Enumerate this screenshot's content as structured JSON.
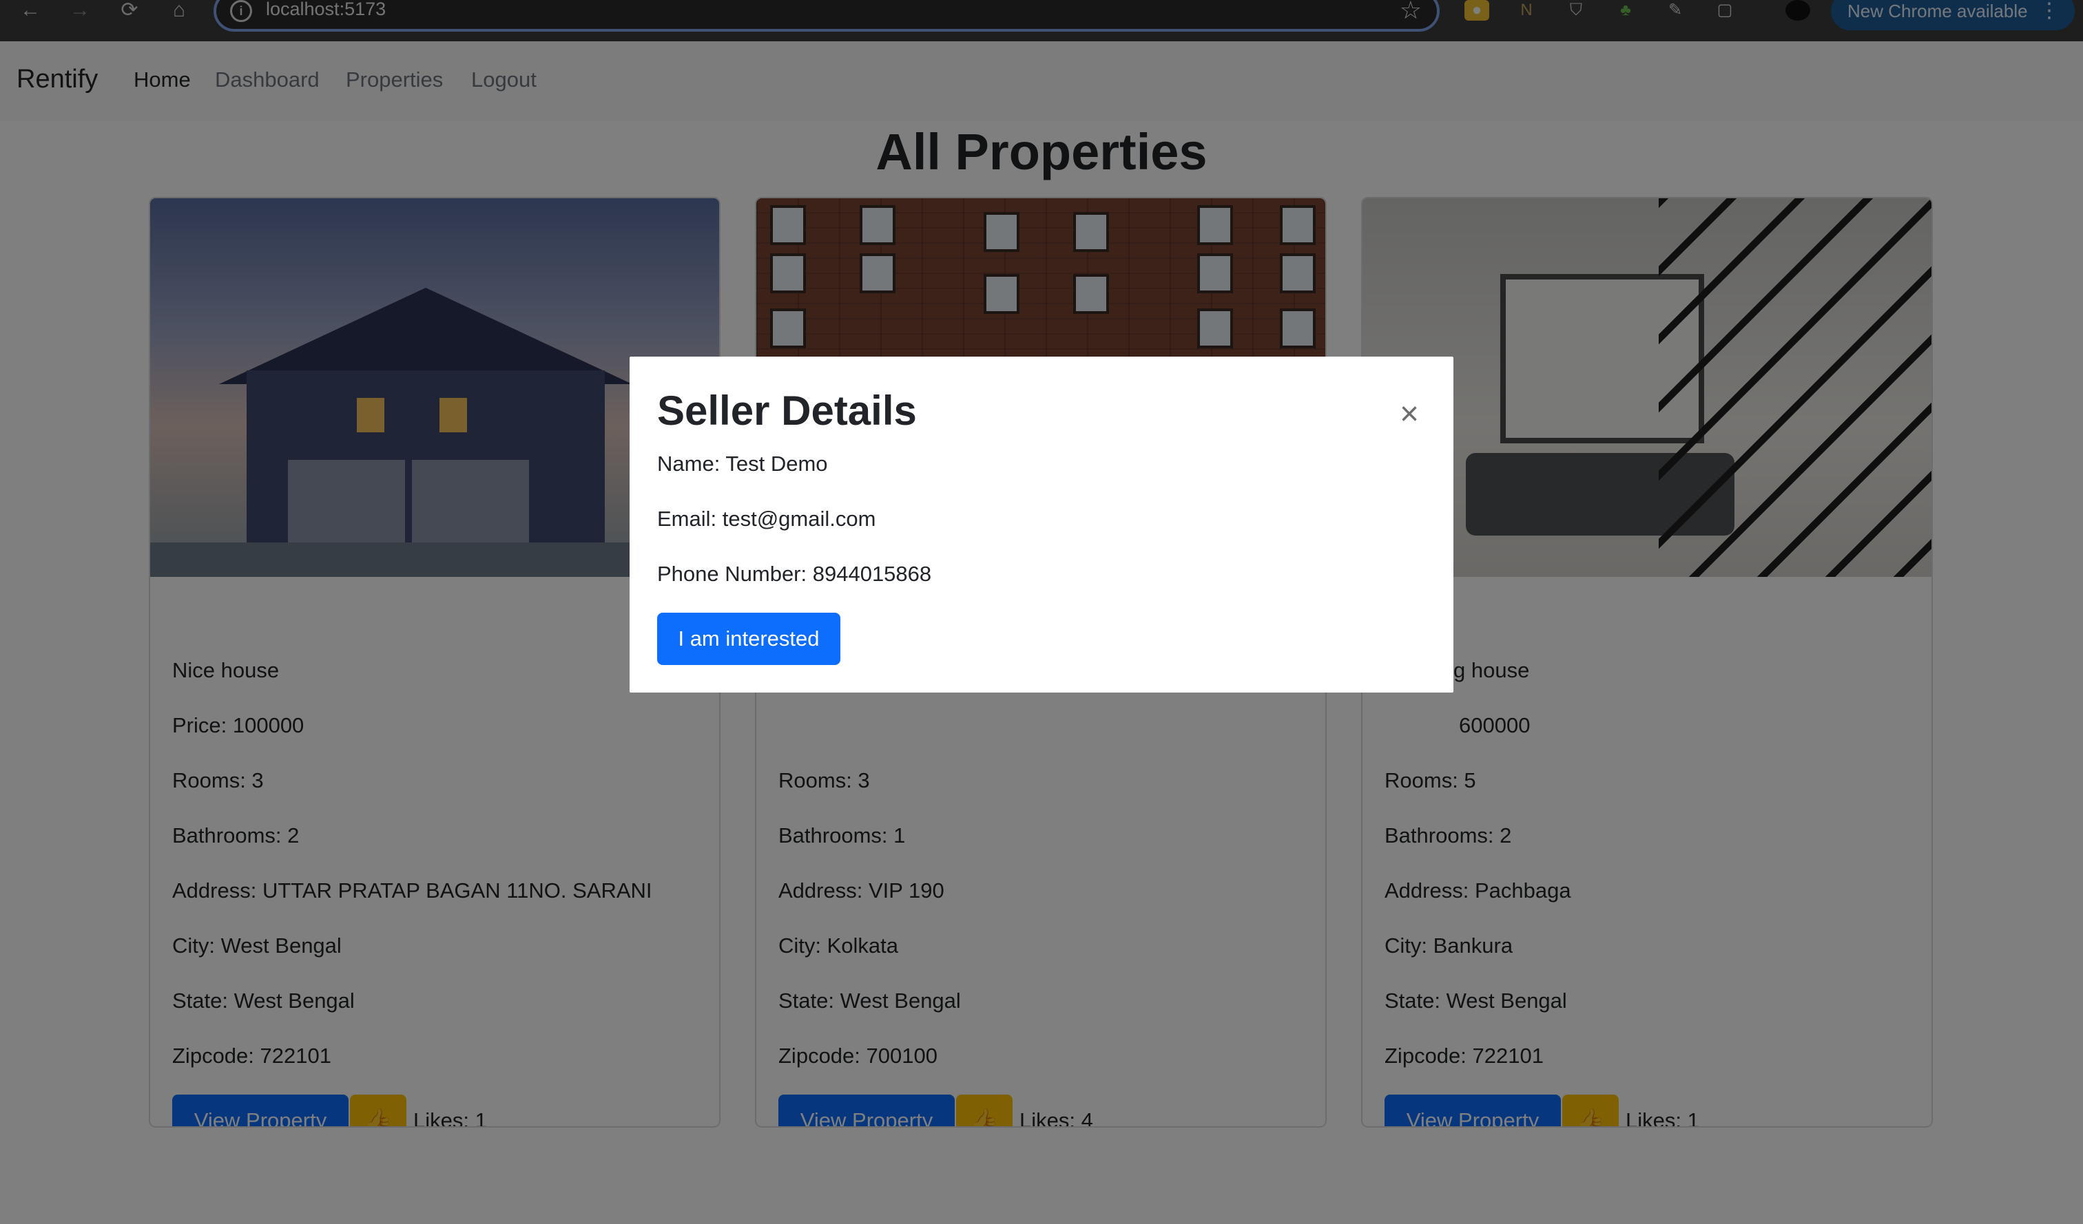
{
  "browser": {
    "url": "localhost:5173",
    "update_label": "New Chrome available"
  },
  "navbar": {
    "brand": "Rentify",
    "links": [
      "Home",
      "Dashboard",
      "Properties",
      "Logout"
    ]
  },
  "page": {
    "title": "All Properties"
  },
  "cards": [
    {
      "name": "Nice house",
      "price": "Price: 100000",
      "rooms": "Rooms: 3",
      "bathrooms": "Bathrooms: 2",
      "address": "Address: UTTAR PRATAP BAGAN 11NO. SARANI",
      "city": "City: West Bengal",
      "state": "State: West Bengal",
      "zipcode": "Zipcode: 722101",
      "view_label": "View Property",
      "like_icon": "👍",
      "likes": "Likes: 1"
    },
    {
      "name": "",
      "price": "",
      "rooms": "Rooms: 3",
      "bathrooms": "Bathrooms: 1",
      "address": "Address: VIP 190",
      "city": "City: Kolkata",
      "state": "State: West Bengal",
      "zipcode": "Zipcode: 700100",
      "view_label": "View Property",
      "like_icon": "👍",
      "likes": "Likes: 4"
    },
    {
      "name": "g house",
      "price": "600000",
      "rooms": "Rooms: 5",
      "bathrooms": "Bathrooms: 2",
      "address": "Address: Pachbaga",
      "city": "City: Bankura",
      "state": "State: West Bengal",
      "zipcode": "Zipcode: 722101",
      "view_label": "View Property",
      "like_icon": "👍",
      "likes": "Likes: 1"
    }
  ],
  "modal": {
    "title": "Seller Details",
    "close_icon": "×",
    "name": "Name: Test Demo",
    "email": "Email: test@gmail.com",
    "phone": "Phone Number: 8944015868",
    "button": "I am interested"
  },
  "colors": {
    "primary": "#0d6efd",
    "warning": "#ffc107",
    "backdrop": "rgba(0,0,0,0.5)"
  }
}
